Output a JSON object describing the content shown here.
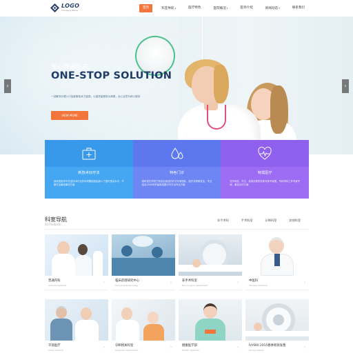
{
  "header": {
    "logo_text": "LOGO",
    "logo_sub": "Company Name",
    "nav": [
      {
        "label": "首页",
        "active": true,
        "dropdown": false
      },
      {
        "label": "科室导航",
        "active": false,
        "dropdown": true
      },
      {
        "label": "医疗特色",
        "active": false,
        "dropdown": false
      },
      {
        "label": "医院概况",
        "active": false,
        "dropdown": true
      },
      {
        "label": "医师介绍",
        "active": false,
        "dropdown": false
      },
      {
        "label": "新闻动态",
        "active": false,
        "dropdown": true
      },
      {
        "label": "联系我们",
        "active": false,
        "dropdown": false
      }
    ],
    "caret": "▾"
  },
  "hero": {
    "subtitle_cn": "爱心传递生命",
    "title": "ONE-STOP SOLUTION",
    "description": "一站解决办理入口及影像技术力量强，以高质量服务为病患，全心全意为病人服务",
    "button_label": "VIEW MORE",
    "arrow_left": "‹",
    "arrow_right": "›"
  },
  "features": [
    {
      "title": "新技术好疗法",
      "desc": "我科室医学中先进技术疗法多年积累经验给病人了国内顶尖水平，不断打出最佳解决方案",
      "icon": "medkit-icon"
    },
    {
      "title": "特色门诊",
      "desc": "我科室在学校已有结合医技的疗法专家团队，医疗共同研发出，专业结合2004年开始新成果中外打出专业方案",
      "icon": "drops-icon"
    },
    {
      "title": "特需医疗",
      "desc": "在外地名，外达，各类优秀的专家专家专家团，专科学科工作专家专家，最佳诊疗方案",
      "icon": "heartbeat-icon"
    }
  ],
  "section": {
    "title": "科室导航",
    "subtitle": "All Products",
    "categories": [
      "非手术科",
      "手术科室",
      "诊断科室",
      "其他科室"
    ]
  },
  "products": [
    {
      "name": "普通内科",
      "meta": "Internal medicine",
      "arrow": "›"
    },
    {
      "name": "临床药理研究中心",
      "meta": "Clinical pharmacology",
      "arrow": "›"
    },
    {
      "name": "非手术科室",
      "meta": "Non-surgical department",
      "arrow": "›"
    },
    {
      "name": "中医科",
      "meta": "Chinese medicine",
      "arrow": "›"
    },
    {
      "name": "干部医疗",
      "meta": "Cadre medical",
      "arrow": "›"
    },
    {
      "name": "诊断相关科室",
      "meta": "Diagnosis department",
      "arrow": "›"
    },
    {
      "name": "健康医学部",
      "meta": "Health medicine",
      "arrow": "›"
    },
    {
      "name": "IVYBOI 2015春季新款发售",
      "meta": "Spring release",
      "arrow": "›"
    }
  ],
  "colors": {
    "accent": "#f2763b",
    "feature1": "#45a6f2",
    "feature2": "#6d86f3",
    "feature3": "#9c6cf2",
    "title_navy": "#1f3c66"
  }
}
